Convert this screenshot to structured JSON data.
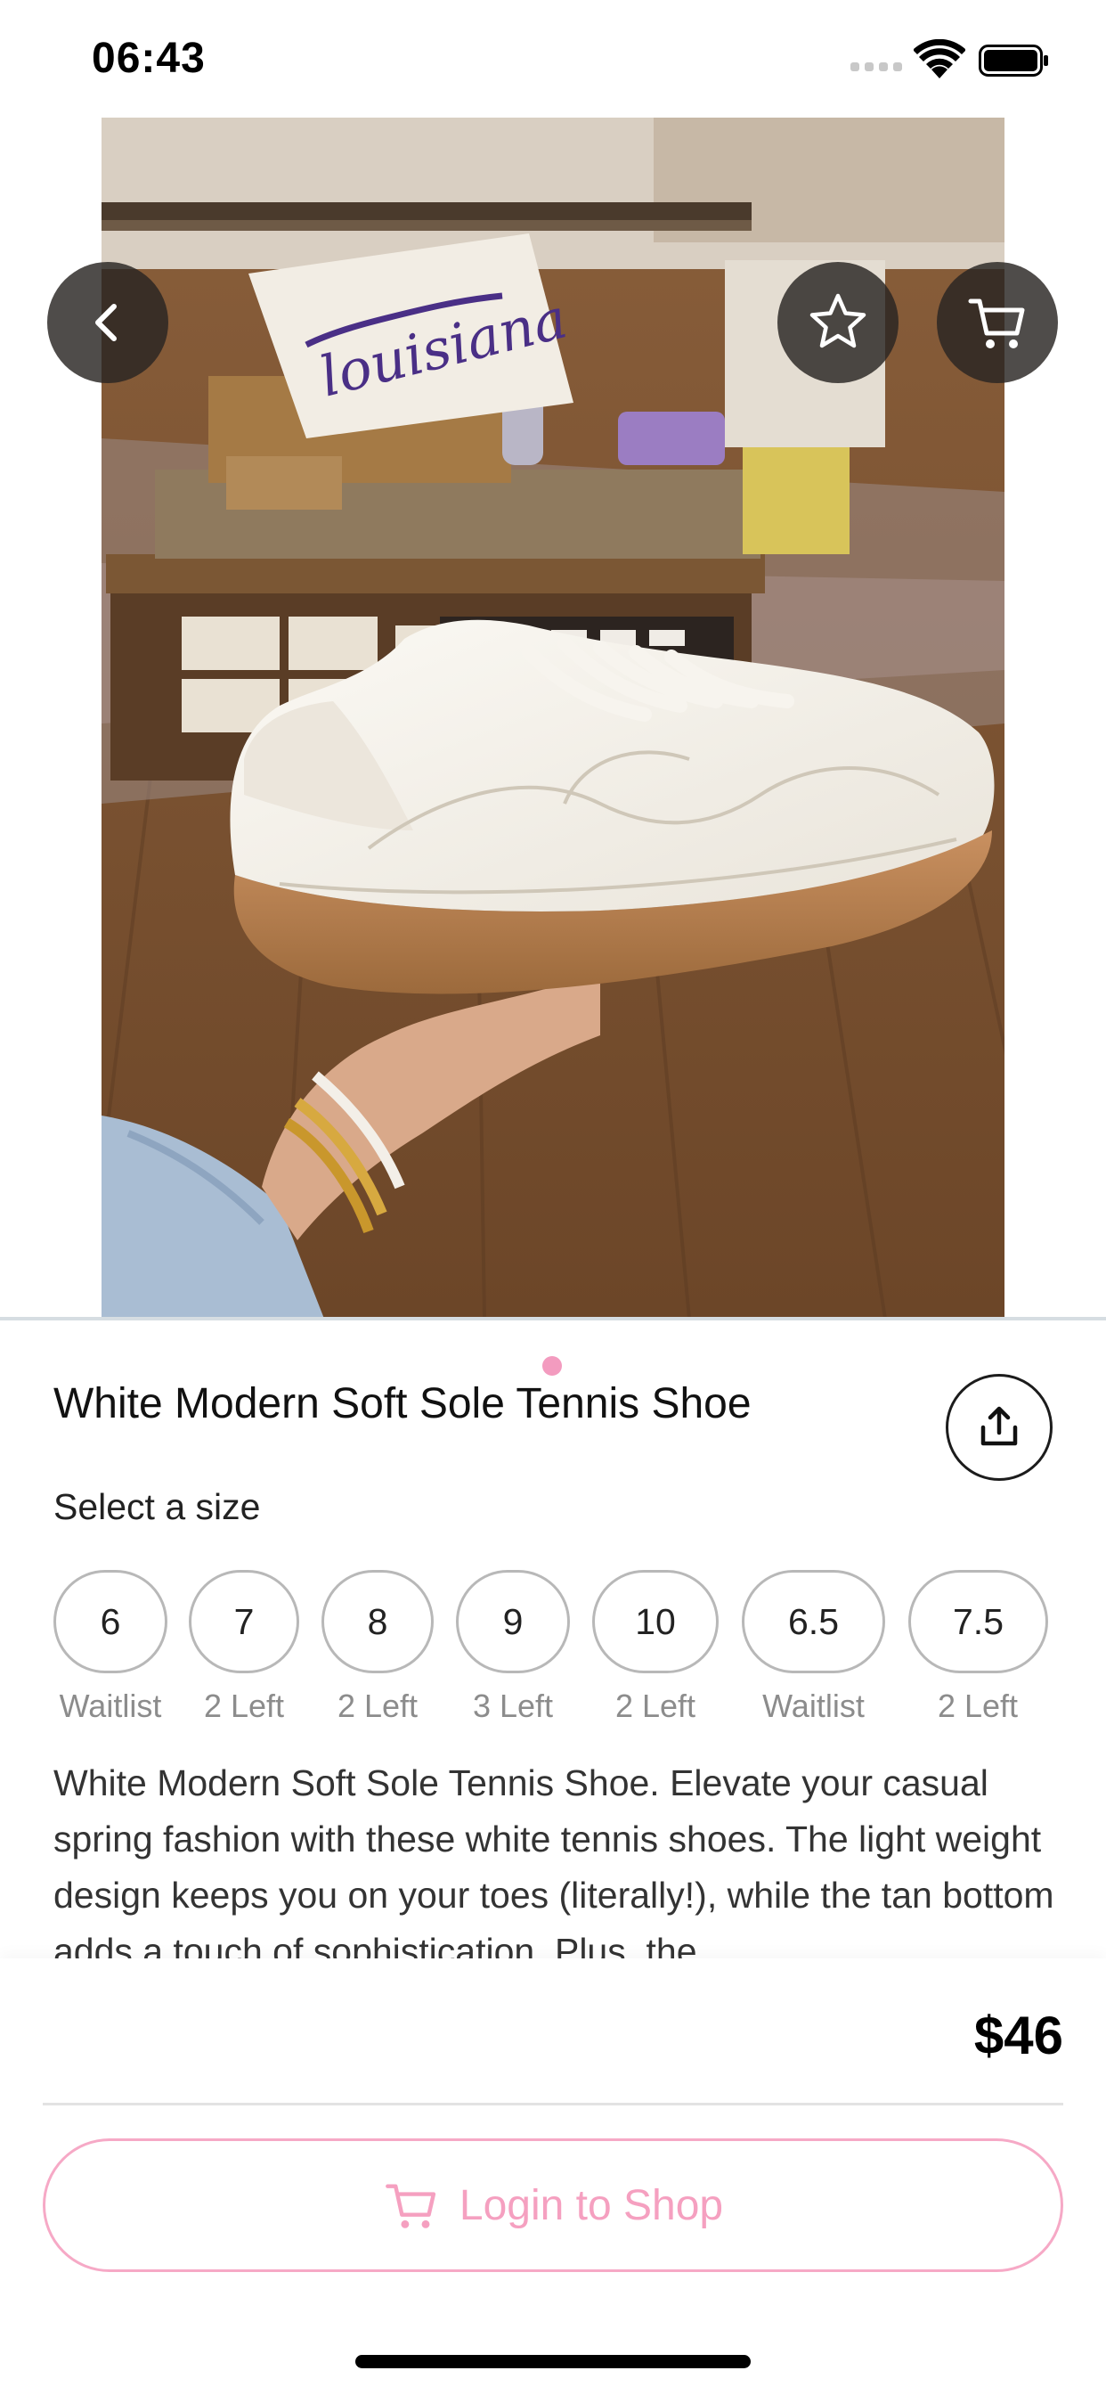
{
  "status_bar": {
    "time": "06:43",
    "icons": [
      "signal-icon",
      "wifi-icon",
      "battery-icon"
    ]
  },
  "hero": {
    "image_alt": "White sneaker held over wood floor in a boutique",
    "pillow_text": "louisiana",
    "page_count": 1,
    "active_page": 1,
    "buttons": {
      "back": "chevron-left-icon",
      "favorite": "star-icon",
      "cart": "cart-icon"
    }
  },
  "product": {
    "title": "White Modern Soft Sole Tennis Shoe",
    "share_icon": "share-icon",
    "size_heading": "Select a size",
    "sizes": [
      {
        "label": "6",
        "availability": "Waitlist"
      },
      {
        "label": "7",
        "availability": "2 Left"
      },
      {
        "label": "8",
        "availability": "2 Left"
      },
      {
        "label": "9",
        "availability": "3 Left"
      },
      {
        "label": "10",
        "availability": "2 Left"
      },
      {
        "label": "6.5",
        "availability": "Waitlist"
      },
      {
        "label": "7.5",
        "availability": "2 Left"
      }
    ],
    "description": "White Modern Soft Sole Tennis Shoe. Elevate your casual spring fashion with these white tennis shoes. The light weight design keeps you on your toes (literally!), while the tan bottom adds a touch of sophistication. Plus, the"
  },
  "purchase": {
    "price": "$46",
    "login_label": "Login to Shop",
    "accent_color": "#f5a0c0"
  }
}
